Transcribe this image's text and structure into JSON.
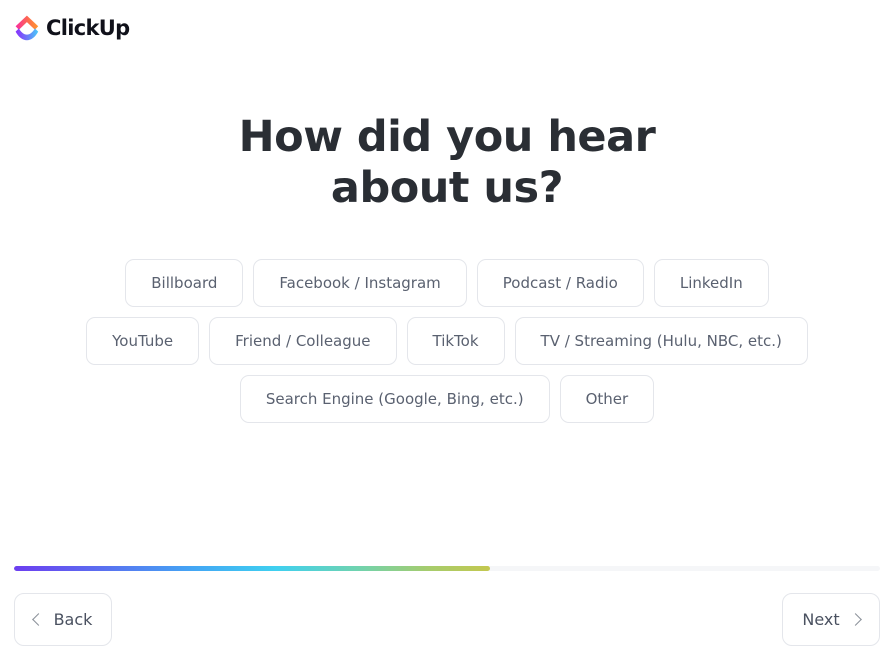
{
  "brand": {
    "name": "ClickUp",
    "logo_icon": "clickup-logo-icon",
    "logo_gradient_top_start": "#f92ba0",
    "logo_gradient_top_end": "#ff9a2e",
    "logo_gradient_bottom_start": "#8930fd",
    "logo_gradient_bottom_end": "#49ccf9"
  },
  "main": {
    "heading_line1": "How did you hear",
    "heading_line2": "about us?",
    "heading_color": "#2a2e34",
    "options": [
      {
        "label": "Billboard"
      },
      {
        "label": "Facebook / Instagram"
      },
      {
        "label": "Podcast / Radio"
      },
      {
        "label": "LinkedIn"
      },
      {
        "label": "YouTube"
      },
      {
        "label": "Friend / Colleague"
      },
      {
        "label": "TikTok"
      },
      {
        "label": "TV / Streaming (Hulu, NBC, etc.)"
      },
      {
        "label": "Search Engine (Google, Bing, etc.)"
      },
      {
        "label": "Other"
      }
    ],
    "option_text_color": "#5a6170",
    "option_border_color": "#e4e6eb"
  },
  "progress": {
    "percent": 55,
    "track_color": "#f5f6f8",
    "gradient_start": "#6c3ef0",
    "gradient_end": "#c4c84f"
  },
  "footer": {
    "back_label": "Back",
    "next_label": "Next",
    "back_icon": "chevron-left-icon",
    "next_icon": "chevron-right-icon"
  }
}
